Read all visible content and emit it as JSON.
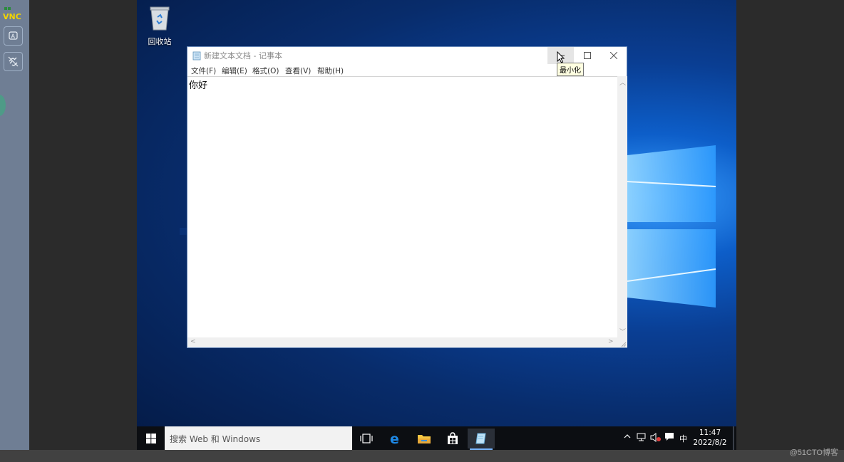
{
  "vnc": {
    "logo_text": "VNC",
    "sidebar_buttons": [
      "keyboard-icon",
      "disconnect-icon"
    ]
  },
  "desktop": {
    "recycle_bin_label": "回收站"
  },
  "notepad": {
    "title": "新建文本文档 - 记事本",
    "menu": [
      "文件(F)",
      "编辑(E)",
      "格式(O)",
      "查看(V)",
      "帮助(H)"
    ],
    "content": "你好",
    "tooltip": "最小化"
  },
  "taskbar": {
    "search_placeholder": "搜索 Web 和 Windows",
    "input_method": "中",
    "time": "11:47",
    "date": "2022/8/2"
  },
  "watermark": "@51CTO博客"
}
